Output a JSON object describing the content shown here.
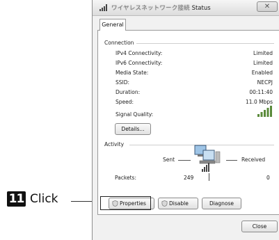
{
  "annotation": {
    "step_number": "11",
    "label": "Click"
  },
  "window": {
    "title_prefix_blurred": "ワイヤレスネットワーク接続",
    "title_suffix": "Status",
    "close_glyph": "✕"
  },
  "tabs": [
    {
      "label": "General"
    }
  ],
  "connection": {
    "group_label": "Connection",
    "rows": [
      {
        "label": "IPv4 Connectivity:",
        "value": "Limited"
      },
      {
        "label": "IPv6 Connectivity:",
        "value": "Limited"
      },
      {
        "label": "Media State:",
        "value": "Enabled"
      },
      {
        "label": "SSID:",
        "value": "NECPJ"
      },
      {
        "label": "Duration:",
        "value": "00:11:40"
      },
      {
        "label": "Speed:",
        "value": "11.0 Mbps"
      }
    ],
    "signal_quality_label": "Signal Quality:",
    "signal_bars": 5,
    "details_button": "Details..."
  },
  "activity": {
    "group_label": "Activity",
    "sent_label": "Sent",
    "received_label": "Received",
    "packets_label": "Packets:",
    "packets_sent": "249",
    "packets_received": "0"
  },
  "buttons": {
    "properties": "Properties",
    "disable": "Disable",
    "diagnose": "Diagnose",
    "close": "Close"
  },
  "colors": {
    "window_bg": "#f1f1f1",
    "panel_bg": "#ffffff",
    "signal_green": "#5a8a3a",
    "annotation_black": "#111111"
  },
  "icons": {
    "titlebar": "signal-bars-icon",
    "network": "network-computers-icon",
    "properties": "shield-icon",
    "disable": "shield-icon"
  }
}
